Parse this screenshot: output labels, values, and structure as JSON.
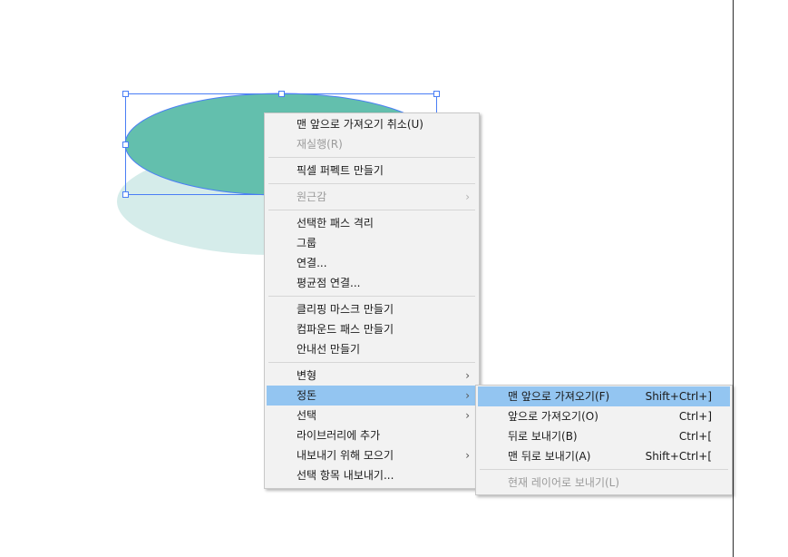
{
  "canvas": {
    "colors": {
      "ellipse_fill": "#63bfad",
      "shadow_fill": "#d5ecea",
      "selection": "#4a7ef5",
      "artboard_edge": "#2b2b2b"
    }
  },
  "context_menu": {
    "groups": [
      [
        {
          "label": "맨 앞으로 가져오기 취소(U)",
          "disabled": false
        },
        {
          "label": "재실행(R)",
          "disabled": true
        }
      ],
      [
        {
          "label": "픽셀 퍼펙트 만들기",
          "disabled": false
        }
      ],
      [
        {
          "label": "원근감",
          "disabled": true,
          "submenu": true
        }
      ],
      [
        {
          "label": "선택한 패스 격리",
          "disabled": false
        },
        {
          "label": "그룹",
          "disabled": false
        },
        {
          "label": "연결...",
          "disabled": false
        },
        {
          "label": "평균점 연결...",
          "disabled": false
        }
      ],
      [
        {
          "label": "클리핑 마스크 만들기",
          "disabled": false
        },
        {
          "label": "컴파운드 패스 만들기",
          "disabled": false
        },
        {
          "label": "안내선 만들기",
          "disabled": false
        }
      ],
      [
        {
          "label": "변형",
          "disabled": false,
          "submenu": true
        },
        {
          "label": "정돈",
          "disabled": false,
          "submenu": true,
          "highlighted": true
        },
        {
          "label": "선택",
          "disabled": false,
          "submenu": true
        },
        {
          "label": "라이브러리에 추가",
          "disabled": false
        },
        {
          "label": "내보내기 위해 모으기",
          "disabled": false,
          "submenu": true
        },
        {
          "label": "선택 항목 내보내기...",
          "disabled": false
        }
      ]
    ],
    "submenu_arrow": "›",
    "highlight_color": "#93c5f1"
  },
  "arrange_submenu": {
    "groups": [
      [
        {
          "label": "맨 앞으로 가져오기(F)",
          "shortcut": "Shift+Ctrl+]",
          "highlighted": true
        },
        {
          "label": "앞으로 가져오기(O)",
          "shortcut": "Ctrl+]"
        },
        {
          "label": "뒤로 보내기(B)",
          "shortcut": "Ctrl+["
        },
        {
          "label": "맨 뒤로 보내기(A)",
          "shortcut": "Shift+Ctrl+["
        }
      ],
      [
        {
          "label": "현재 레이어로 보내기(L)",
          "shortcut": "",
          "disabled": true
        }
      ]
    ]
  }
}
